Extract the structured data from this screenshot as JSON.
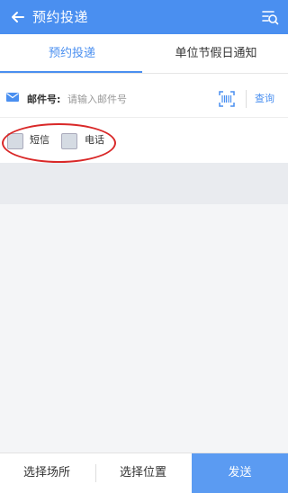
{
  "header": {
    "title": "预约投递",
    "back_icon": "back-arrow-icon",
    "menu_icon": "list-search-icon",
    "color": "#4a8ff0"
  },
  "tabs": [
    {
      "label": "预约投递",
      "active": true
    },
    {
      "label": "单位节假日通知",
      "active": false
    }
  ],
  "search": {
    "icon": "mail-icon",
    "label": "邮件号:",
    "value": "",
    "placeholder": "请输入邮件号",
    "scan_icon": "barcode-scan-icon",
    "query_label": "查询"
  },
  "notify": {
    "sms_label": "短信",
    "phone_label": "电话",
    "sms_checked": false,
    "phone_checked": false,
    "highlight_color": "#d92828"
  },
  "bottom": {
    "choose_site": "选择场所",
    "choose_position": "选择位置",
    "submit": "发送"
  }
}
